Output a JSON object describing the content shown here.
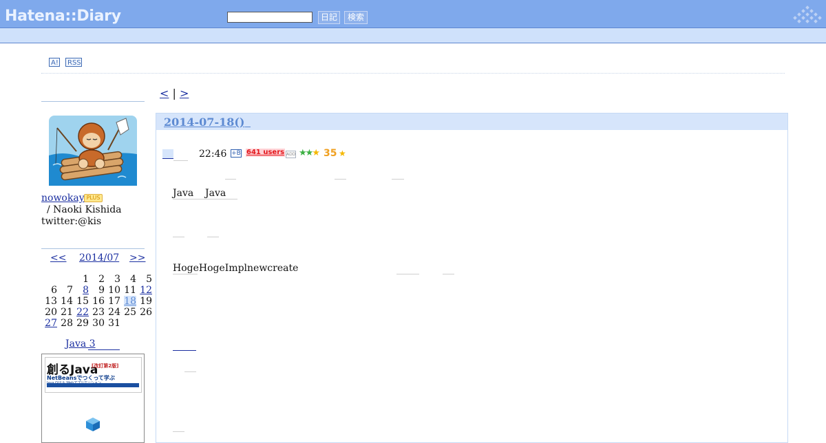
{
  "header": {
    "logo": "Hatena::Diary",
    "search_placeholder": "",
    "diary_button": "日記",
    "search_button": "検索"
  },
  "toolbar": {
    "antenna_label": "A!",
    "rss_label": "RSS"
  },
  "sidebar": {
    "username": "nowokay",
    "plus_badge": "PLUS",
    "realname": "/ Naoki Kishida",
    "twitter": "twitter:@kis",
    "calendar": {
      "prev": "<<",
      "month": "2014/07",
      "next": ">>",
      "weeks": [
        [
          "",
          "",
          "1",
          "2",
          "3",
          "4",
          "5"
        ],
        [
          "6",
          "7",
          "8",
          "9",
          "10",
          "11",
          "12"
        ],
        [
          "13",
          "14",
          "15",
          "16",
          "17",
          "18",
          "19"
        ],
        [
          "20",
          "21",
          "22",
          "23",
          "24",
          "25",
          "26"
        ],
        [
          "27",
          "28",
          "29",
          "30",
          "31",
          "",
          ""
        ]
      ],
      "linked_days": [
        "8",
        "12",
        "18",
        "22",
        "27"
      ],
      "today": "18"
    },
    "book_title": "Java 3",
    "book_cover": {
      "main": "創るJava",
      "edition": "[改訂第2版]",
      "subtitle": "NetBeansでつくって学ぶ",
      "subtitle2": "Java GUI & Webアプリケーション"
    }
  },
  "main": {
    "pager_prev": "<",
    "pager_sep": "|",
    "pager_next": ">",
    "date": "2014-07-18()",
    "entry": {
      "time": "22:46",
      "bookmark_icon": "+B",
      "users": "641 users",
      "add_icon": "ADD",
      "stars": "★★★",
      "star_count": "35",
      "star_add": "★"
    },
    "paragraphs": {
      "p1": "Java",
      "p1b": "Java",
      "p2": "HogeHogeImplnewcreate"
    }
  },
  "colors": {
    "header_bg": "#7fa9ec",
    "subbar_bg": "#cfe1fb",
    "date_header_bg": "#d6e5fb",
    "link": "#1a2ea0",
    "date_text": "#5d8ad2",
    "users_badge_text": "#e2151a"
  }
}
